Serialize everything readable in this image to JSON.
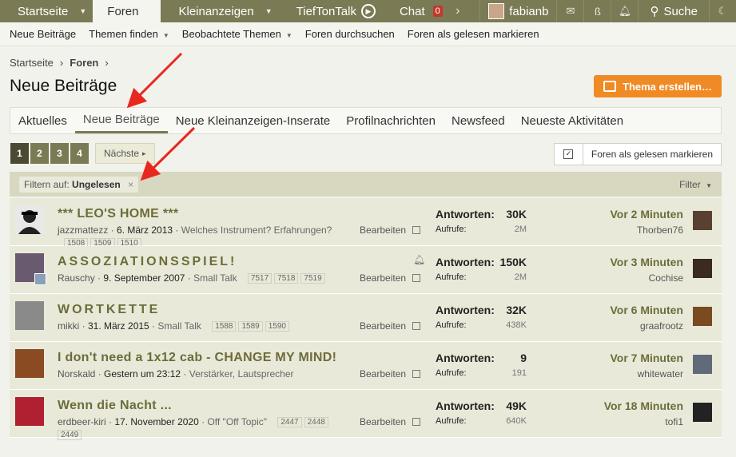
{
  "topnav": {
    "home": "Startseite",
    "forums": "Foren",
    "classifieds": "Kleinanzeigen",
    "tieftontalk": "TiefTonTalk",
    "chat": "Chat",
    "chat_count": "0",
    "user": "fabianb",
    "search": "Suche"
  },
  "subnav": {
    "new_posts": "Neue Beiträge",
    "find_threads": "Themen finden",
    "watched": "Beobachtete Themen",
    "search_forums": "Foren durchsuchen",
    "mark_read": "Foren als gelesen markieren"
  },
  "breadcrumb": [
    "Startseite",
    "Foren"
  ],
  "page": {
    "title": "Neue Beiträge",
    "create_label": "Thema erstellen…"
  },
  "tabs": [
    "Aktuelles",
    "Neue Beiträge",
    "Neue Kleinanzeigen-Inserate",
    "Profilnachrichten",
    "Newsfeed",
    "Neueste Aktivitäten"
  ],
  "pager": {
    "pages": [
      "1",
      "2",
      "3",
      "4"
    ],
    "next": "Nächste"
  },
  "mark_read_button": "Foren als gelesen markieren",
  "filter": {
    "prefix": "Filtern auf:",
    "value": "Ungelesen",
    "remove": "×",
    "menu": "Filter"
  },
  "labels": {
    "replies": "Antworten:",
    "views": "Aufrufe:",
    "edit": "Bearbeiten"
  },
  "threads": [
    {
      "title": "*** LEO'S HOME ***",
      "author": "jazzmattezz",
      "date": "6. März 2013",
      "forum": "Welches Instrument? Erfahrungen?",
      "pages": [
        "1508",
        "1509",
        "1510"
      ],
      "replies": "30K",
      "views": "2M",
      "time": "Vor 2 Minuten",
      "last_user": "Thorben76"
    },
    {
      "title": "ASSOZIATIONSSPIEL!",
      "author": "Rauschy",
      "date": "9. September 2007",
      "forum": "Small Talk",
      "pages": [
        "7517",
        "7518",
        "7519"
      ],
      "replies": "150K",
      "views": "2M",
      "time": "Vor 3 Minuten",
      "last_user": "Cochise"
    },
    {
      "title": "WORTKETTE",
      "author": "mikki",
      "date": "31. März 2015",
      "forum": "Small Talk",
      "pages": [
        "1588",
        "1589",
        "1590"
      ],
      "replies": "32K",
      "views": "438K",
      "time": "Vor 6 Minuten",
      "last_user": "graafrootz"
    },
    {
      "title": "I don't need a 1x12 cab - CHANGE MY MIND!",
      "author": "Norskald",
      "date": "Gestern um 23:12",
      "forum": "Verstärker, Lautsprecher",
      "pages": [],
      "replies": "9",
      "views": "191",
      "time": "Vor 7 Minuten",
      "last_user": "whitewater"
    },
    {
      "title": "Wenn die Nacht ...",
      "author": "erdbeer-kiri",
      "date": "17. November 2020",
      "forum": "Off \"Off Topic\"",
      "pages": [
        "2447",
        "2448"
      ],
      "pages_line2": [
        "2449"
      ],
      "replies": "49K",
      "views": "640K",
      "time": "Vor 18 Minuten",
      "last_user": "tofi1"
    }
  ]
}
